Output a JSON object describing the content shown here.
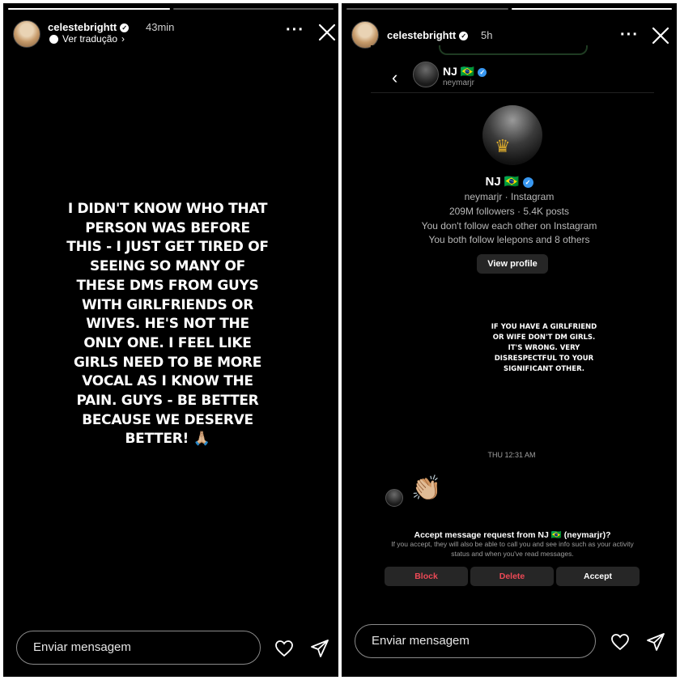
{
  "left_story": {
    "username": "celestebrightt",
    "time": "43min",
    "translate_label": "Ver tradução",
    "translate_chevron": "›",
    "menu_dots": "···",
    "story_text": "I DIDN'T KNOW WHO THAT PERSON WAS BEFORE THIS - I JUST GET TIRED OF SEEING SO MANY OF THESE DMS FROM GUYS WITH GIRLFRIENDS OR WIVES. HE'S NOT THE ONLY ONE. I FEEL LIKE GIRLS NEED TO BE MORE VOCAL AS I KNOW THE PAIN. GUYS - BE BETTER BECAUSE WE DESERVE BETTER! 🙏🏼",
    "message_placeholder": "Enviar mensagem",
    "progress": [
      1.0,
      0.0
    ]
  },
  "right_story": {
    "username": "celestebrightt",
    "time": "5h",
    "menu_dots": "···",
    "message_placeholder": "Enviar mensagem",
    "progress": [
      0.0,
      1.0
    ],
    "dm": {
      "back_glyph": "‹",
      "header_name": "NJ 🇧🇷",
      "header_handle": "neymarjr",
      "profile_name": "NJ 🇧🇷",
      "profile_handle_line": "neymarjr · Instagram",
      "followers_line": "209M followers · 5.4K posts",
      "follow_status": "You don't follow each other on Instagram",
      "mutuals": "You both follow lelepons and 8 others",
      "view_profile": "View profile",
      "story_caption": "IF YOU HAVE A GIRLFRIEND OR WIFE DON'T DM GIRLS. IT'S WRONG. VERY DISRESPECTFUL TO YOUR SIGNIFICANT OTHER.",
      "timestamp": "THU 12:31 AM",
      "message_emoji": "👏🏼",
      "request_title": "Accept message request from NJ 🇧🇷 (neymarjr)?",
      "request_body": "If you accept, they will also be able to call you and see info such as your activity status and when you've read messages.",
      "block": "Block",
      "delete": "Delete",
      "accept": "Accept"
    }
  },
  "colors": {
    "background": "#000000",
    "danger": "#ed4956",
    "verified_blue": "#3897f0"
  },
  "icons": [
    "verified-icon",
    "globe-icon",
    "chevron-right-icon",
    "more-icon",
    "close-icon",
    "heart-icon",
    "send-icon",
    "back-chevron-icon",
    "crown-icon"
  ]
}
